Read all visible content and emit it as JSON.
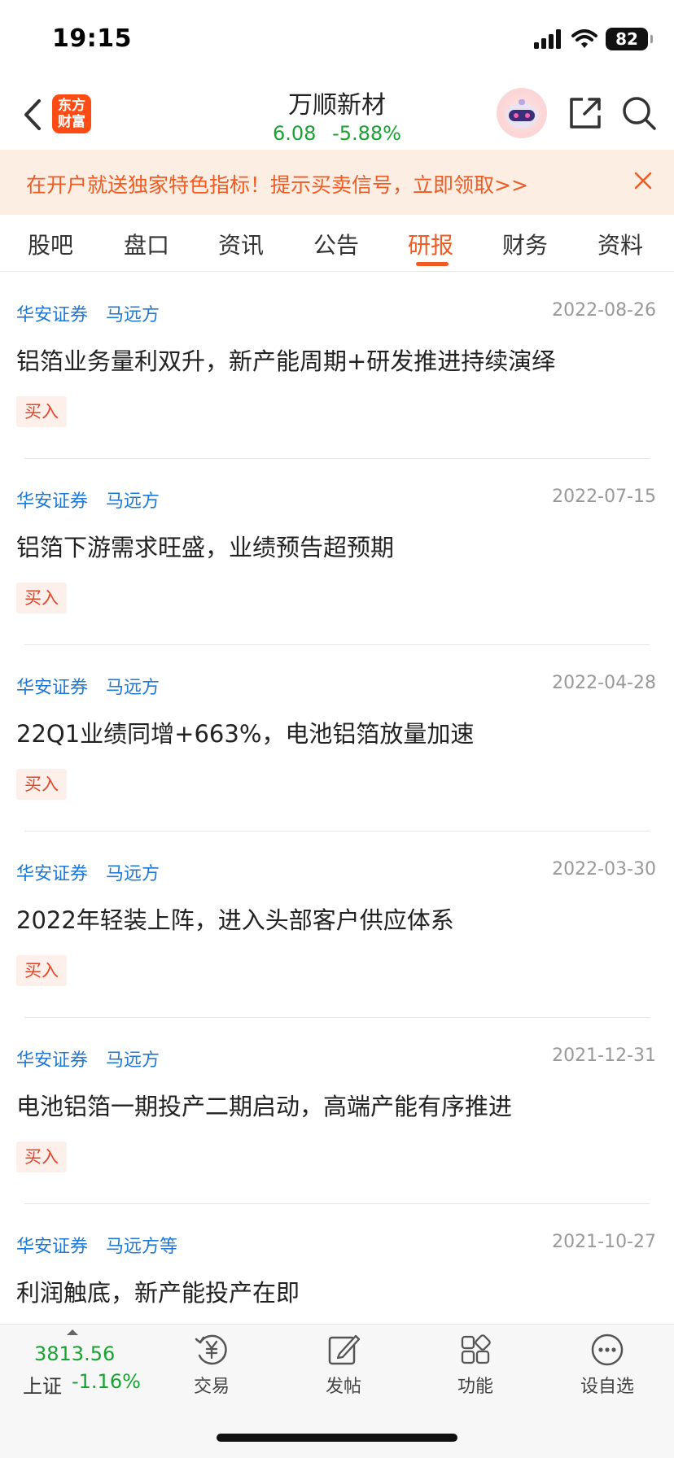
{
  "status_bar": {
    "time": "19:15",
    "battery": "82"
  },
  "header": {
    "logo_text": "东方财富",
    "stock_name": "万顺新材",
    "price": "6.08",
    "change_pct": "-5.88%",
    "icons": [
      "back-arrow-icon",
      "robot-assistant-icon",
      "share-icon",
      "search-icon"
    ]
  },
  "promo": {
    "text": "在开户就送独家特色指标！提示买卖信号，立即领取>>"
  },
  "tabs": [
    {
      "label": "股吧",
      "active": false
    },
    {
      "label": "盘口",
      "active": false
    },
    {
      "label": "资讯",
      "active": false
    },
    {
      "label": "公告",
      "active": false
    },
    {
      "label": "研报",
      "active": true
    },
    {
      "label": "财务",
      "active": false
    },
    {
      "label": "资料",
      "active": false
    }
  ],
  "reports": [
    {
      "org": "华安证券",
      "author": "马远方",
      "date": "2022-08-26",
      "title": "铝箔业务量利双升，新产能周期+研发推进持续演绎",
      "rating": "买入"
    },
    {
      "org": "华安证券",
      "author": "马远方",
      "date": "2022-07-15",
      "title": "铝箔下游需求旺盛，业绩预告超预期",
      "rating": "买入"
    },
    {
      "org": "华安证券",
      "author": "马远方",
      "date": "2022-04-28",
      "title": "22Q1业绩同增+663%，电池铝箔放量加速",
      "rating": "买入"
    },
    {
      "org": "华安证券",
      "author": "马远方",
      "date": "2022-03-30",
      "title": "2022年轻装上阵，进入头部客户供应体系",
      "rating": "买入"
    },
    {
      "org": "华安证券",
      "author": "马远方",
      "date": "2021-12-31",
      "title": "电池铝箔一期投产二期启动，高端产能有序推进",
      "rating": "买入"
    },
    {
      "org": "华安证券",
      "author": "马远方等",
      "date": "2021-10-27",
      "title": "利润触底，新产能投产在即",
      "rating": ""
    }
  ],
  "bottom_bar": {
    "index_value": "3813.56",
    "index_name": "上证",
    "index_change": "-1.16%",
    "nav": [
      {
        "label": "交易",
        "icon": "trade-yen-icon"
      },
      {
        "label": "发帖",
        "icon": "compose-post-icon"
      },
      {
        "label": "功能",
        "icon": "grid-apps-icon"
      },
      {
        "label": "设自选",
        "icon": "more-dots-icon"
      }
    ]
  },
  "colors": {
    "accent": "#f05a23",
    "down_green": "#16a32f",
    "link_blue": "#1d78d6"
  }
}
